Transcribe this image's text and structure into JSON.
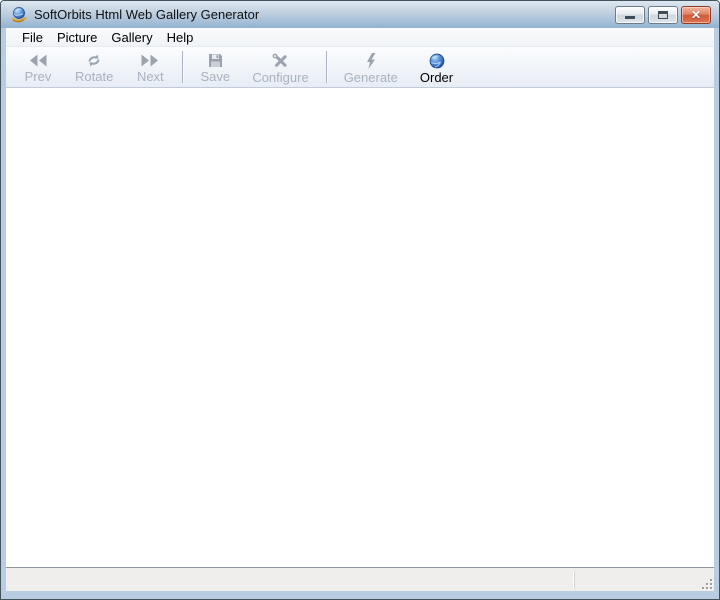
{
  "window": {
    "title": "SoftOrbits Html Web Gallery Generator",
    "app_icon": "softorbits-globe-icon",
    "controls": [
      {
        "name": "minimize-button",
        "icon": "minimize-icon"
      },
      {
        "name": "maximize-button",
        "icon": "maximize-icon"
      },
      {
        "name": "close-button",
        "icon": "close-icon",
        "glyph": "✕"
      }
    ]
  },
  "menu": {
    "items": [
      {
        "label": "File"
      },
      {
        "label": "Picture"
      },
      {
        "label": "Gallery"
      },
      {
        "label": "Help"
      }
    ]
  },
  "toolbar": {
    "buttons": [
      {
        "label": "Prev",
        "icon": "prev-icon",
        "enabled": false
      },
      {
        "label": "Rotate",
        "icon": "rotate-icon",
        "enabled": false
      },
      {
        "label": "Next",
        "icon": "next-icon",
        "enabled": false
      },
      {
        "label": "Save",
        "icon": "save-icon",
        "enabled": false
      },
      {
        "label": "Configure",
        "icon": "configure-icon",
        "enabled": false
      },
      {
        "label": "Generate",
        "icon": "generate-icon",
        "enabled": false
      },
      {
        "label": "Order",
        "icon": "globe-icon",
        "enabled": true
      }
    ],
    "groups": [
      [
        "Prev",
        "Rotate",
        "Next"
      ],
      [
        "Save",
        "Configure"
      ],
      [
        "Generate",
        "Order"
      ]
    ]
  },
  "content": {
    "text": ""
  },
  "statusbar": {
    "panels": [
      {
        "text": ""
      },
      {
        "text": ""
      }
    ]
  },
  "colors": {
    "titlebar_top": "#dde7f0",
    "titlebar_bottom": "#93b2cf",
    "frame": "#b9cde2",
    "frame_outline": "#44525e",
    "close_button_red": "#d05a3a",
    "toolbar_bg": "#f0f4f9",
    "disabled_gray": "#a9b2bd",
    "globe_blue": "#2a5db0",
    "content_bg": "#ffffff",
    "statusbar_bg": "#efeeed"
  }
}
